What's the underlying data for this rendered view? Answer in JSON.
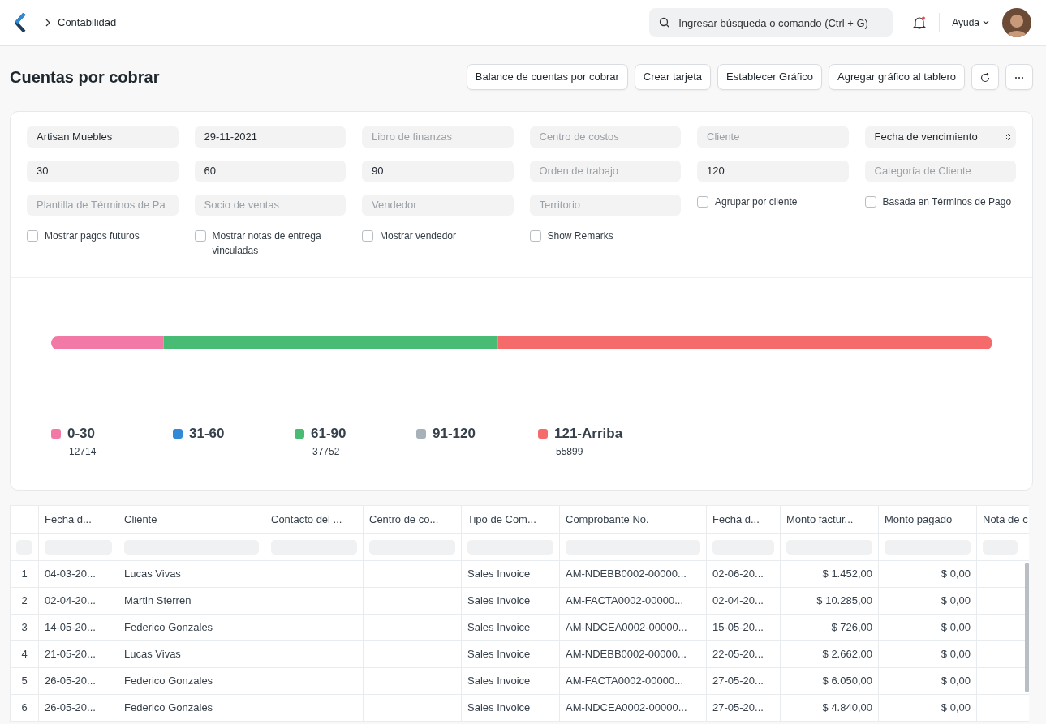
{
  "navbar": {
    "breadcrumb": "Contabilidad",
    "search": {
      "placeholder": "Ingresar búsqueda o comando (Ctrl + G)"
    },
    "notifications": {
      "unread": true
    },
    "help": "Ayuda"
  },
  "page": {
    "title": "Cuentas por cobrar",
    "buttons": [
      "Balance de cuentas por cobrar",
      "Crear tarjeta",
      "Establecer Gráfico",
      "Agregar gráfico al tablero"
    ]
  },
  "filters": [
    {
      "kind": "input",
      "value": "Artisan Muebles"
    },
    {
      "kind": "input",
      "value": "29-11-2021"
    },
    {
      "kind": "input",
      "placeholder": "Libro de finanzas"
    },
    {
      "kind": "input",
      "placeholder": "Centro de costos"
    },
    {
      "kind": "input",
      "placeholder": "Cliente"
    },
    {
      "kind": "select",
      "value": "Fecha de vencimiento"
    },
    {
      "kind": "input",
      "value": "30"
    },
    {
      "kind": "input",
      "value": "60"
    },
    {
      "kind": "input",
      "value": "90"
    },
    {
      "kind": "input",
      "placeholder": "Orden de trabajo"
    },
    {
      "kind": "input",
      "value": "120"
    },
    {
      "kind": "input",
      "placeholder": "Categoría de Cliente"
    },
    {
      "kind": "input",
      "placeholder": "Plantilla de Términos de Pa"
    },
    {
      "kind": "input",
      "placeholder": "Socio de ventas"
    },
    {
      "kind": "input",
      "placeholder": "Vendedor"
    },
    {
      "kind": "input",
      "placeholder": "Territorio"
    },
    {
      "kind": "check",
      "label": "Agrupar por cliente",
      "checked": false
    },
    {
      "kind": "check",
      "label": "Basada en Términos de Pago",
      "checked": false
    },
    {
      "kind": "check",
      "label": "Mostrar pagos futuros",
      "checked": false
    },
    {
      "kind": "check",
      "label": "Mostrar notas de entrega vinculadas",
      "checked": false
    },
    {
      "kind": "check",
      "label": "Mostrar vendedor",
      "checked": false
    },
    {
      "kind": "check",
      "label": "Show Remarks",
      "checked": false
    }
  ],
  "aging_buckets": [
    {
      "label": "0-30",
      "color": "#f279a6",
      "amount": "12714"
    },
    {
      "label": "31-60",
      "color": "#318ad8"
    },
    {
      "label": "61-90",
      "color": "#48bb74",
      "amount": "37752"
    },
    {
      "label": "91-120",
      "color": "#a6b1b9"
    },
    {
      "label": "121-Arriba",
      "color": "#f56b6b",
      "amount": "55899"
    }
  ],
  "table": {
    "columns": [
      {
        "label": "Fecha d...",
        "kind": "text"
      },
      {
        "label": "Cliente",
        "kind": "text"
      },
      {
        "label": "Contacto del ...",
        "kind": "text"
      },
      {
        "label": "Centro de co...",
        "kind": "text"
      },
      {
        "label": "Tipo de Com...",
        "kind": "text"
      },
      {
        "label": "Comprobante No.",
        "kind": "text"
      },
      {
        "label": "Fecha d...",
        "kind": "text"
      },
      {
        "label": "Monto factur...",
        "kind": "currency"
      },
      {
        "label": "Monto pagado",
        "kind": "currency"
      },
      {
        "label": "Nota de c",
        "kind": "currency"
      }
    ],
    "rows": [
      {
        "index": "1",
        "cells": [
          "04-03-20...",
          "Lucas Vivas",
          "",
          "",
          "Sales Invoice",
          "AM-NDEBB0002-00000...",
          "02-06-20...",
          "$ 1.452,00",
          "$ 0,00",
          ""
        ]
      },
      {
        "index": "2",
        "cells": [
          "02-04-20...",
          "Martin Sterren",
          "",
          "",
          "Sales Invoice",
          "AM-FACTA0002-00000...",
          "02-04-20...",
          "$ 10.285,00",
          "$ 0,00",
          ""
        ]
      },
      {
        "index": "3",
        "cells": [
          "14-05-20...",
          "Federico Gonzales",
          "",
          "",
          "Sales Invoice",
          "AM-NDCEA0002-00000...",
          "15-05-20...",
          "$ 726,00",
          "$ 0,00",
          ""
        ]
      },
      {
        "index": "4",
        "cells": [
          "21-05-20...",
          "Lucas Vivas",
          "",
          "",
          "Sales Invoice",
          "AM-NDEBB0002-00000...",
          "22-05-20...",
          "$ 2.662,00",
          "$ 0,00",
          ""
        ]
      },
      {
        "index": "5",
        "cells": [
          "26-05-20...",
          "Federico Gonzales",
          "",
          "",
          "Sales Invoice",
          "AM-FACTA0002-00000...",
          "27-05-20...",
          "$ 6.050,00",
          "$ 0,00",
          ""
        ]
      },
      {
        "index": "6",
        "cells": [
          "26-05-20...",
          "Federico Gonzales",
          "",
          "",
          "Sales Invoice",
          "AM-NDCEA0002-00000...",
          "27-05-20...",
          "$ 4.840,00",
          "$ 0,00",
          ""
        ]
      }
    ]
  }
}
